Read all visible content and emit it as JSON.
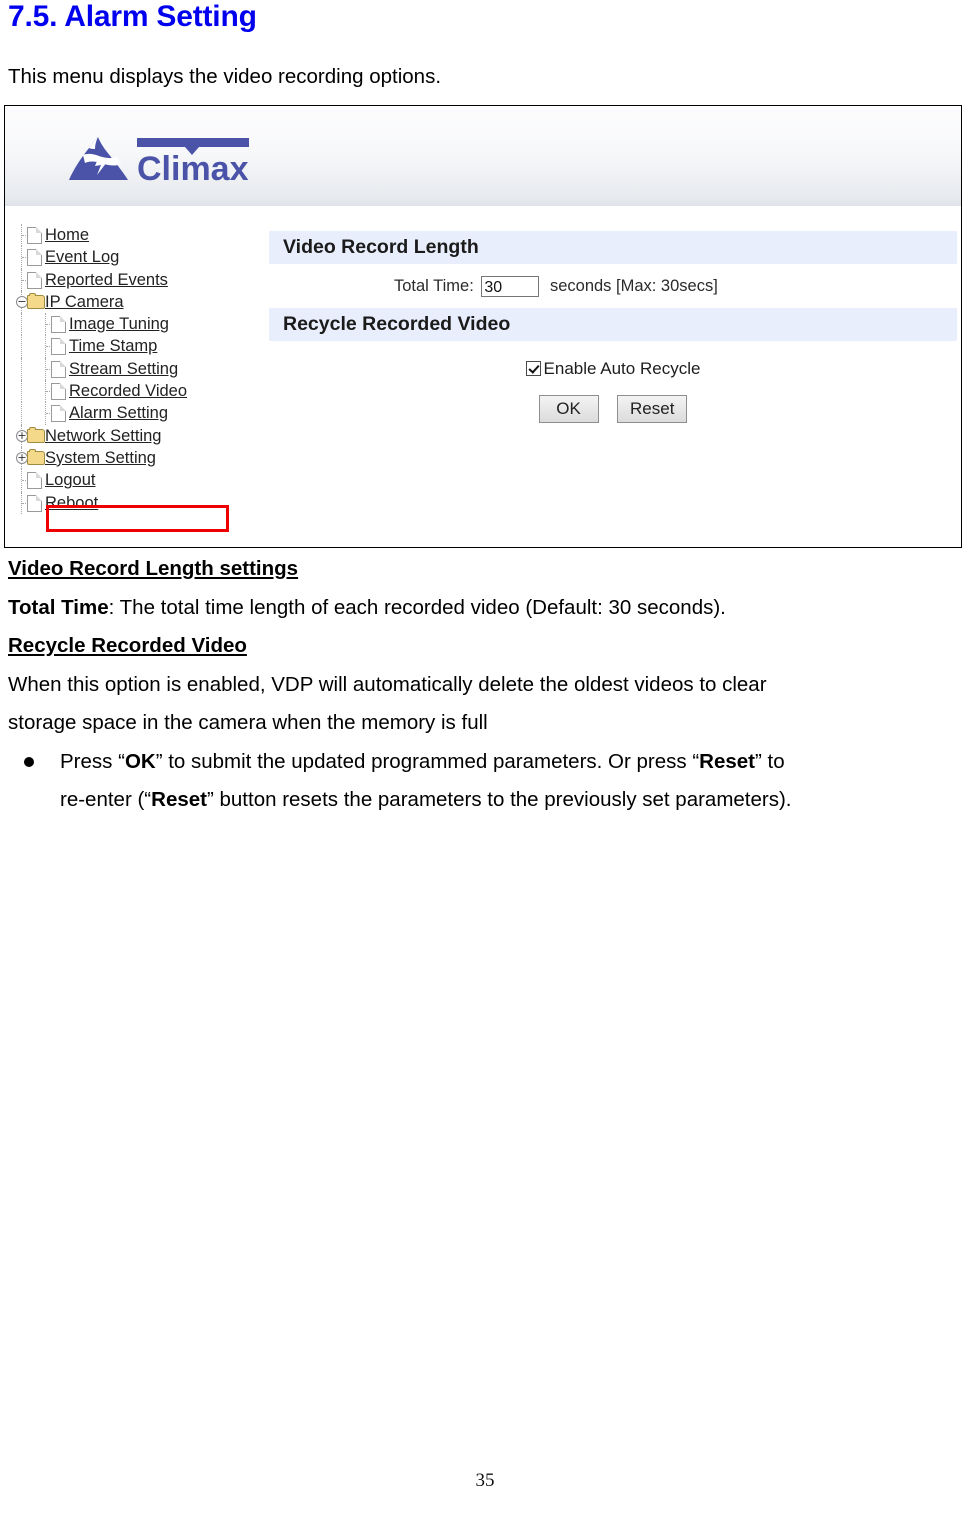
{
  "document": {
    "heading": "7.5. Alarm Setting",
    "intro": "This menu displays the video recording options.",
    "page_number": "35"
  },
  "screenshot": {
    "brand": {
      "logo_text": "Climax",
      "logo_color": "#4a53a8"
    },
    "tree": {
      "items": [
        {
          "label": "Home",
          "icon": "page-icon",
          "level": 0,
          "toggle": ""
        },
        {
          "label": "Event Log",
          "icon": "page-icon",
          "level": 0,
          "toggle": ""
        },
        {
          "label": "Reported Events",
          "icon": "page-icon",
          "level": 0,
          "toggle": ""
        },
        {
          "label": "IP Camera",
          "icon": "folder-open-icon",
          "level": 0,
          "toggle": "−"
        },
        {
          "label": "Image Tuning",
          "icon": "page-icon",
          "level": 1,
          "toggle": ""
        },
        {
          "label": "Time Stamp",
          "icon": "page-icon",
          "level": 1,
          "toggle": ""
        },
        {
          "label": "Stream Setting",
          "icon": "page-icon",
          "level": 1,
          "toggle": ""
        },
        {
          "label": "Recorded Video",
          "icon": "page-icon",
          "level": 1,
          "toggle": ""
        },
        {
          "label": "Alarm Setting",
          "icon": "page-icon",
          "level": 1,
          "toggle": "",
          "highlighted": true
        },
        {
          "label": "Network Setting",
          "icon": "folder-icon",
          "level": 0,
          "toggle": "+"
        },
        {
          "label": "System Setting",
          "icon": "folder-icon",
          "level": 0,
          "toggle": "+"
        },
        {
          "label": "Logout",
          "icon": "page-icon",
          "level": 0,
          "toggle": ""
        },
        {
          "label": "Reboot",
          "icon": "page-icon",
          "level": 0,
          "toggle": ""
        }
      ],
      "highlight_color": "#ee0000"
    },
    "panel": {
      "section_video_length": {
        "title": "Video Record Length",
        "total_time_label": "Total Time:",
        "total_time_value": "30",
        "total_time_suffix": "seconds [Max: 30secs]"
      },
      "section_recycle": {
        "title": "Recycle Recorded Video",
        "checkbox_label": "Enable Auto Recycle",
        "checkbox_checked": true
      },
      "buttons": {
        "ok": "OK",
        "reset": "Reset"
      },
      "section_bar_color": "#e8eefb"
    }
  },
  "body_copy": {
    "heading_1": "Video Record Length settings",
    "line_total_time_bold": "Total Time",
    "line_total_time_rest": ": The total time length of each recorded video (Default: 30 seconds).",
    "heading_2": "Recycle Recorded Video",
    "paragraph_line_1": "When this option is enabled, VDP will automatically delete the oldest videos to clear",
    "paragraph_line_2": "storage space in the camera when the memory is full",
    "bullet": {
      "seg_1": "Press “",
      "seg_2_bold": "OK",
      "seg_3": "” to submit the updated programmed parameters. Or press “",
      "seg_4_bold": "Reset",
      "seg_5": "” to",
      "seg_6": "re-enter (“",
      "seg_7_bold": "Reset",
      "seg_8": "” button resets the parameters to the previously set parameters)."
    }
  }
}
